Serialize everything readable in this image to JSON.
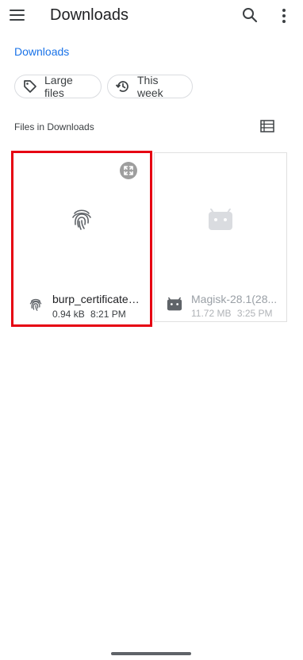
{
  "header": {
    "title": "Downloads"
  },
  "breadcrumb": {
    "label": "Downloads"
  },
  "chips": [
    {
      "label": "Large files",
      "icon": "tag-icon"
    },
    {
      "label": "This week",
      "icon": "history-icon"
    }
  ],
  "section": {
    "label": "Files in Downloads"
  },
  "files": [
    {
      "name": "burp_certificate....",
      "size": "0.94 kB",
      "time": "8:21 PM",
      "icon": "fingerprint-icon",
      "selected": true
    },
    {
      "name": "Magisk-28.1(28...",
      "size": "11.72 MB",
      "time": "3:25 PM",
      "icon": "android-icon",
      "selected": false
    }
  ],
  "colors": {
    "accent": "#1a73e8",
    "selection": "#e60012"
  }
}
